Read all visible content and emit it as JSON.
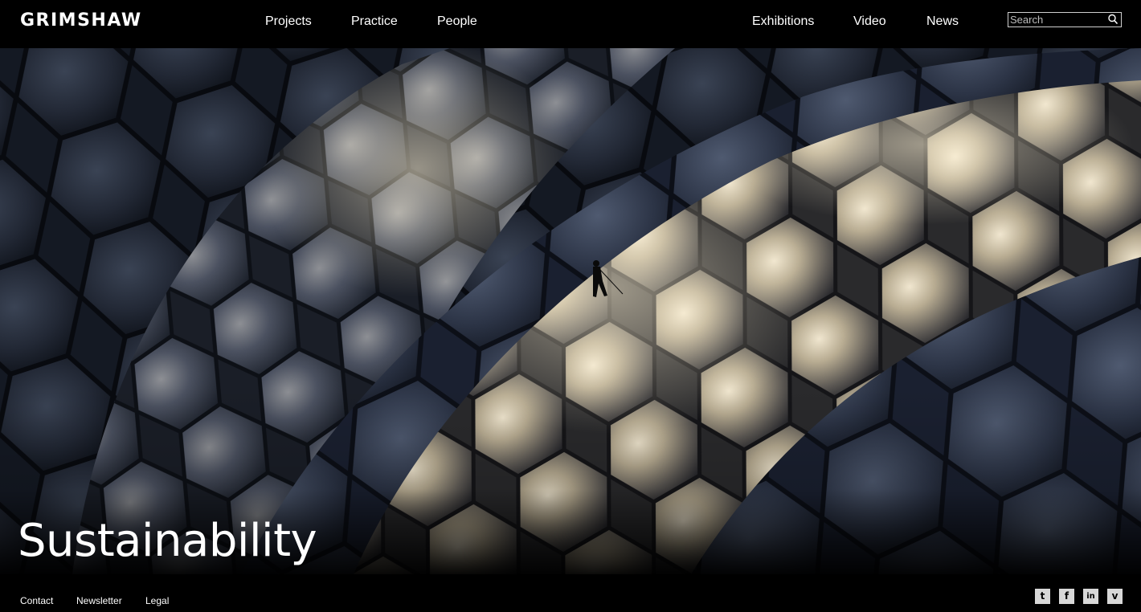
{
  "header": {
    "logo": "GRIMSHAW",
    "nav_left": [
      {
        "label": "Projects"
      },
      {
        "label": "Practice"
      },
      {
        "label": "People"
      }
    ],
    "nav_right": [
      {
        "label": "Exhibitions"
      },
      {
        "label": "Video"
      },
      {
        "label": "News"
      }
    ],
    "search": {
      "placeholder": "Search",
      "value": "",
      "icon": "magnifier-icon"
    }
  },
  "hero": {
    "title": "Sustainability",
    "image": "eden-project-biome-hexagonal-cushions-photo"
  },
  "footer": {
    "links": [
      {
        "label": "Contact"
      },
      {
        "label": "Newsletter"
      },
      {
        "label": "Legal"
      }
    ],
    "social": [
      {
        "icon": "twitter-icon",
        "glyph": "t"
      },
      {
        "icon": "facebook-icon",
        "glyph": "f"
      },
      {
        "icon": "linkedin-icon",
        "glyph": "in"
      },
      {
        "icon": "vimeo-icon",
        "glyph": "v"
      }
    ]
  },
  "colors": {
    "background": "#000000",
    "text": "#ffffff",
    "social_tile": "#d8d8d8"
  }
}
